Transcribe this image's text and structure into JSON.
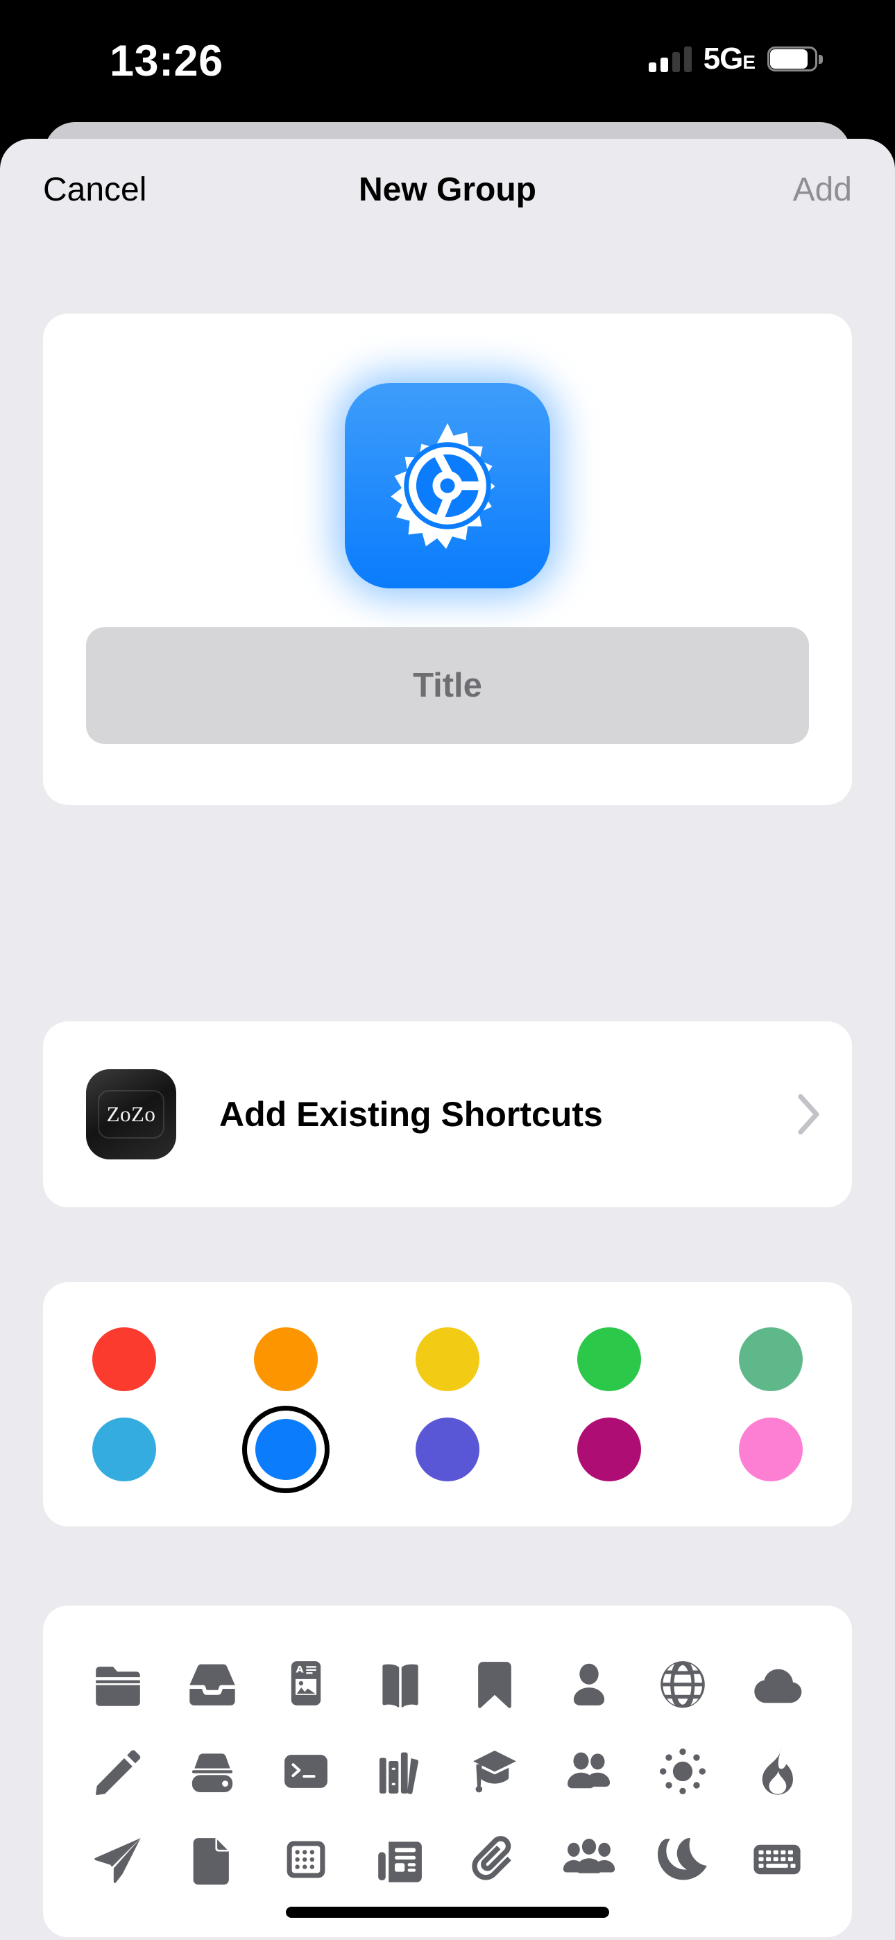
{
  "status_bar": {
    "time": "13:26",
    "network_label_main": "5G",
    "network_label_sub": "E",
    "signal_icon": "cellular-bars-icon",
    "battery_icon": "battery-icon",
    "signal_bars_filled": 2,
    "signal_bars_total": 4
  },
  "nav": {
    "cancel_label": "Cancel",
    "title": "New Group",
    "add_label": "Add"
  },
  "icon_card": {
    "glyph_icon": "gear-icon",
    "glyph_tile_color": "#0a7cfc",
    "title_placeholder": "Title"
  },
  "shortcuts_row": {
    "app_icon": "zozo-app-icon",
    "app_icon_label": "ZoZo",
    "label": "Add Existing Shortcuts",
    "chevron_icon": "chevron-right-icon"
  },
  "colors": {
    "selected_index": 6,
    "swatches": [
      {
        "name": "red",
        "hex": "#fb3b2d"
      },
      {
        "name": "orange",
        "hex": "#fc9500"
      },
      {
        "name": "yellow",
        "hex": "#f2cb14"
      },
      {
        "name": "green",
        "hex": "#2bc84a"
      },
      {
        "name": "sea-green",
        "hex": "#5eb88a"
      },
      {
        "name": "light-blue",
        "hex": "#35ace0"
      },
      {
        "name": "blue",
        "hex": "#0b7cfb"
      },
      {
        "name": "indigo",
        "hex": "#5a57d6"
      },
      {
        "name": "magenta",
        "hex": "#ae0e74"
      },
      {
        "name": "pink",
        "hex": "#fd7fd3"
      }
    ]
  },
  "glyphs": {
    "color": "#5f6065",
    "items": [
      "folder-icon",
      "tray-icon",
      "news-card-icon",
      "book-icon",
      "bookmark-icon",
      "person-icon",
      "globe-icon",
      "cloud-icon",
      "pencil-icon",
      "eraser-icon",
      "terminal-icon",
      "books-icon",
      "graduation-cap-icon",
      "two-people-icon",
      "sun-icon",
      "flame-icon",
      "paper-plane-icon",
      "document-icon",
      "calculator-icon",
      "newspaper-icon",
      "paperclip-icon",
      "three-people-icon",
      "moon-icon",
      "keyboard-icon"
    ]
  },
  "home_indicator": "home-indicator"
}
